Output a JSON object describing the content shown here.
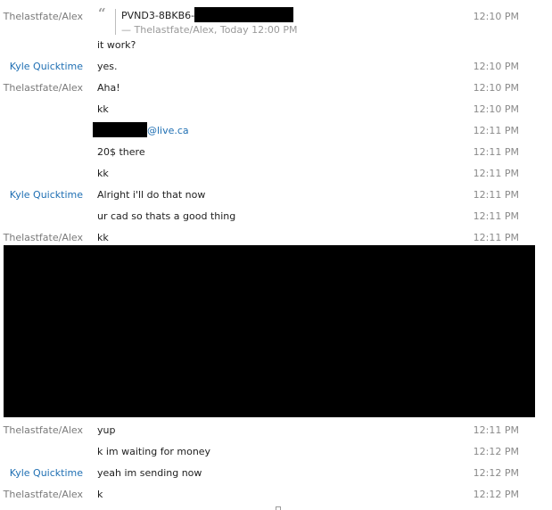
{
  "quote": {
    "sender": "Thelastfate/Alex",
    "text": "PVND3-8BKB6-",
    "attribution": "— Thelastfate/Alex, Today 12:00 PM",
    "time": "12:10 PM"
  },
  "messages": [
    {
      "sender": "",
      "text": "it work?",
      "time": ""
    },
    {
      "sender": "Kyle Quicktime",
      "text": "yes.",
      "time": "12:10 PM"
    },
    {
      "sender": "Thelastfate/Alex",
      "text": "Aha!",
      "time": "12:10 PM"
    },
    {
      "sender": "",
      "text": "kk",
      "time": "12:10 PM"
    },
    {
      "sender": "",
      "text": "@live.ca",
      "time": "12:11 PM"
    },
    {
      "sender": "",
      "text": "20$ there",
      "time": "12:11 PM"
    },
    {
      "sender": "",
      "text": "kk",
      "time": "12:11 PM"
    },
    {
      "sender": "Kyle Quicktime",
      "text": "Alright i'll do that now",
      "time": "12:11 PM"
    },
    {
      "sender": "",
      "text": "ur cad so thats a good thing",
      "time": "12:11 PM"
    },
    {
      "sender": "Thelastfate/Alex",
      "text": "kk",
      "time": "12:11 PM"
    },
    {
      "sender": "Thelastfate/Alex",
      "text": "yup",
      "time": "12:11 PM"
    },
    {
      "sender": "",
      "text": "k im waiting for money",
      "time": "12:12 PM"
    },
    {
      "sender": "Kyle Quicktime",
      "text": "yeah im sending now",
      "time": "12:12 PM"
    },
    {
      "sender": "Thelastfate/Alex",
      "text": "k",
      "time": "12:12 PM"
    }
  ],
  "colors": {
    "link": "#1f6fb3",
    "sender_default": "#7a7a7a",
    "redaction": "#000000"
  }
}
